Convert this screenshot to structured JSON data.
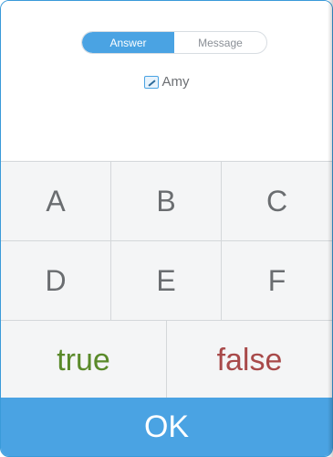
{
  "tabs": [
    {
      "label": "Answer",
      "active": true
    },
    {
      "label": "Message",
      "active": false
    }
  ],
  "user": {
    "name": "Amy",
    "icon": "edit-icon"
  },
  "keys": {
    "row1": [
      "A",
      "B",
      "C"
    ],
    "row2": [
      "D",
      "E",
      "F"
    ],
    "true_label": "true",
    "false_label": "false"
  },
  "ok_label": "OK",
  "colors": {
    "accent": "#4aa3e3",
    "true": "#5a8a2a",
    "false": "#a84a4a"
  }
}
